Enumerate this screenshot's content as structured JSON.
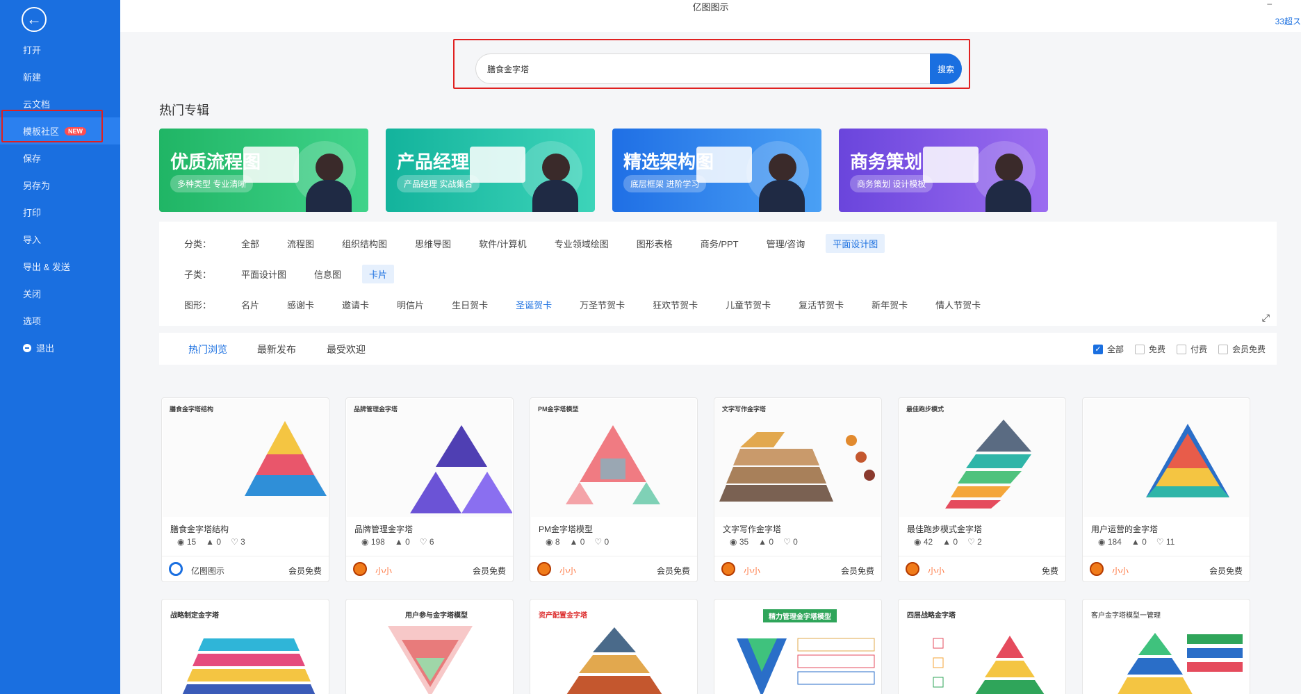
{
  "app_title": "亿图图示",
  "corner_text": "33超ス",
  "window_min": "–",
  "sidebar": {
    "back_icon": "back-arrow-icon",
    "items": [
      {
        "label": "打开"
      },
      {
        "label": "新建"
      },
      {
        "label": "云文档"
      },
      {
        "label": "模板社区",
        "badge": "NEW",
        "active": true
      },
      {
        "label": "保存"
      },
      {
        "label": "另存为"
      },
      {
        "label": "打印"
      },
      {
        "label": "导入"
      },
      {
        "label": "导出 & 发送"
      },
      {
        "label": "关闭"
      },
      {
        "label": "选项"
      },
      {
        "label": "退出"
      }
    ]
  },
  "search": {
    "value": "膳食金字塔",
    "button": "搜索"
  },
  "hot_section": {
    "title": "热门专辑",
    "banners": [
      {
        "title": "优质流程图",
        "subtitle": "多种类型 专业清晰",
        "color": "#2fbf71"
      },
      {
        "title": "产品经理",
        "subtitle": "产品经理 实战集合",
        "color": "#21b8a6"
      },
      {
        "title": "精选架构图",
        "subtitle": "底层框架 进阶学习",
        "color": "#2d7de8"
      },
      {
        "title": "商务策划",
        "subtitle": "商务策划 设计模板",
        "color": "#7c4fe0"
      }
    ]
  },
  "filters": {
    "category": {
      "label": "分类：",
      "options": [
        "全部",
        "流程图",
        "组织结构图",
        "思维导图",
        "软件/计算机",
        "专业领域绘图",
        "图形表格",
        "商务/PPT",
        "管理/咨询",
        "平面设计图"
      ],
      "selected": "平面设计图"
    },
    "subcategory": {
      "label": "子类：",
      "options": [
        "平面设计图",
        "信息图",
        "卡片"
      ],
      "selected": "卡片"
    },
    "shape": {
      "label": "图形：",
      "options": [
        "名片",
        "感谢卡",
        "邀请卡",
        "明信片",
        "生日贺卡",
        "圣诞贺卡",
        "万圣节贺卡",
        "狂欢节贺卡",
        "儿童节贺卡",
        "复活节贺卡",
        "新年贺卡",
        "情人节贺卡"
      ],
      "highlighted": "圣诞贺卡"
    }
  },
  "sort": {
    "tabs": [
      "热门浏览",
      "最新发布",
      "最受欢迎"
    ],
    "active": "热门浏览",
    "checks": [
      {
        "label": "全部",
        "checked": true
      },
      {
        "label": "免费",
        "checked": false
      },
      {
        "label": "付费",
        "checked": false
      },
      {
        "label": "会员免费",
        "checked": false
      }
    ]
  },
  "cards": [
    {
      "thumb_title": "膳食金字塔结构",
      "name": "膳食金字塔结构",
      "views": "15",
      "likes": "0",
      "favs": "3",
      "author": "亿图图示",
      "price": "会员免费",
      "brand": true
    },
    {
      "thumb_title": "品牌管理金字塔",
      "name": "品牌管理金字塔",
      "views": "198",
      "likes": "0",
      "favs": "6",
      "author": "小小",
      "price": "会员免费",
      "brand": false
    },
    {
      "thumb_title": "PM金字塔模型",
      "name": "PM金字塔模型",
      "views": "8",
      "likes": "0",
      "favs": "0",
      "author": "小小",
      "price": "会员免费",
      "brand": false
    },
    {
      "thumb_title": "文字写作金字塔",
      "name": "文字写作金字塔",
      "views": "35",
      "likes": "0",
      "favs": "0",
      "author": "小小",
      "price": "会员免费",
      "brand": false
    },
    {
      "thumb_title": "最佳跑步模式",
      "name": "最佳跑步模式金字塔",
      "views": "42",
      "likes": "0",
      "favs": "2",
      "author": "小小",
      "price": "免费",
      "brand": false
    },
    {
      "thumb_title": "",
      "name": "用户运营的金字塔",
      "views": "184",
      "likes": "0",
      "favs": "11",
      "author": "小小",
      "price": "会员免费",
      "brand": false
    }
  ],
  "cards_row2": [
    {
      "thumb_title": "战略制定金字塔"
    },
    {
      "thumb_title": "用户参与金字塔模型"
    },
    {
      "thumb_title": "资产配置金字塔"
    },
    {
      "thumb_title": "精力管理金字塔模型"
    },
    {
      "thumb_title": "四层战略金字塔"
    },
    {
      "thumb_title": "客户金字塔模型一管理"
    }
  ]
}
